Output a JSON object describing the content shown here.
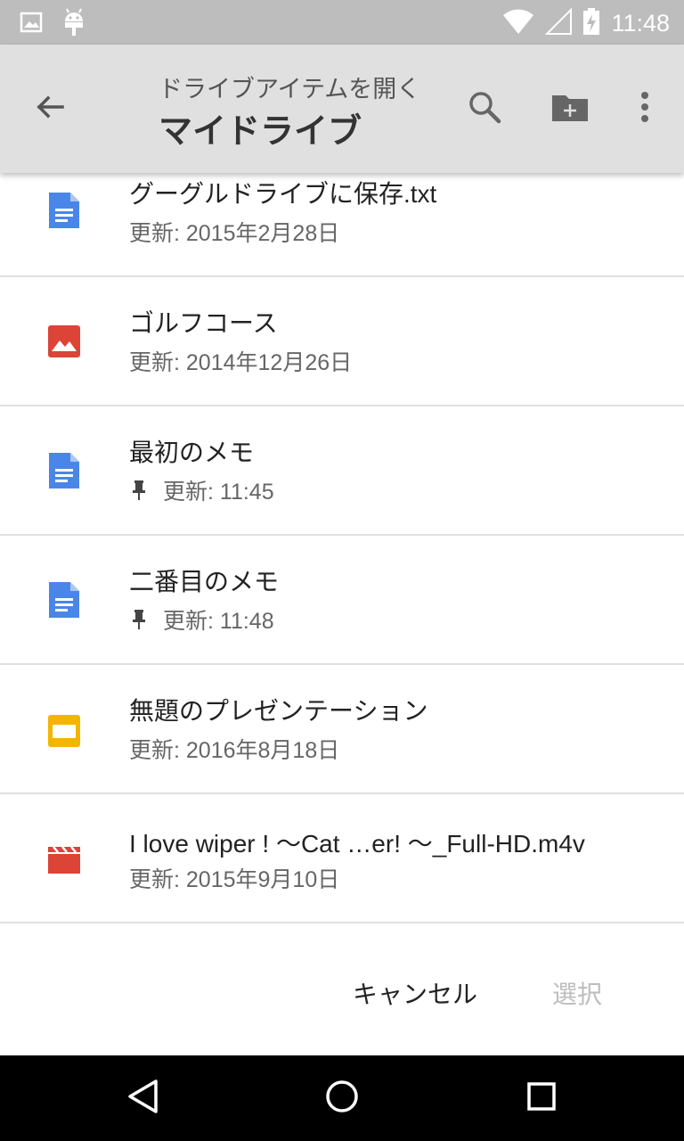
{
  "status_bar": {
    "time": "11:48",
    "left_icons": [
      "image-icon",
      "android-icon"
    ],
    "right_icons": [
      "wifi-icon",
      "signal-icon",
      "battery-charging-icon"
    ]
  },
  "toolbar": {
    "subtitle": "ドライブアイテムを開く",
    "title": "マイドライブ",
    "icons": [
      "back-arrow-icon",
      "search-icon",
      "new-folder-icon",
      "more-vert-icon"
    ]
  },
  "files": [
    {
      "name": "グーグルドライブに保存.txt",
      "meta": "更新: 2015年2月28日",
      "type": "doc",
      "icon": "doc-icon",
      "pinned": false
    },
    {
      "name": "ゴルフコース",
      "meta": "更新: 2014年12月26日",
      "type": "image",
      "icon": "image-file-icon",
      "pinned": false
    },
    {
      "name": "最初のメモ",
      "meta": "更新: 11:45",
      "type": "doc",
      "icon": "doc-icon",
      "pinned": true
    },
    {
      "name": "二番目のメモ",
      "meta": "更新: 11:48",
      "type": "doc",
      "icon": "doc-icon",
      "pinned": true
    },
    {
      "name": "無題のプレゼンテーション",
      "meta": "更新: 2016年8月18日",
      "type": "slides",
      "icon": "slides-icon",
      "pinned": false
    },
    {
      "name": "I love wiper !  〜Cat …er! 〜_Full-HD.m4v",
      "meta": "更新: 2015年9月10日",
      "type": "video",
      "icon": "video-icon",
      "pinned": false
    }
  ],
  "footer": {
    "cancel_label": "キャンセル",
    "select_label": "選択"
  },
  "colors": {
    "doc": "#4a86e8",
    "image": "#db4437",
    "slides": "#f4b400",
    "video": "#db4437",
    "toolbar_bg": "#e0e0e0",
    "status_bg": "#bdbdbd"
  },
  "nav_bar": {
    "icons": [
      "back-triangle-icon",
      "home-circle-icon",
      "recents-square-icon"
    ]
  }
}
